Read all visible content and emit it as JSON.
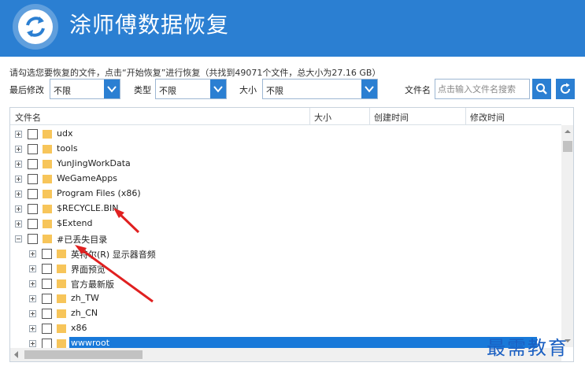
{
  "app": {
    "title": "涂师傅数据恢复"
  },
  "hint": "请勾选您要恢复的文件，点击“开始恢复”进行恢复（共找到49071个文件，总大小为27.16 GB）",
  "filters": {
    "modified_label": "最后修改",
    "modified_value": "不限",
    "type_label": "类型",
    "type_value": "不限",
    "size_label": "大小",
    "size_value": "不限",
    "filename_label": "文件名",
    "filename_placeholder": "点击输入文件名搜索"
  },
  "columns": {
    "name": "文件名",
    "size": "大小",
    "created": "创建时间",
    "modified": "修改时间"
  },
  "rows": [
    {
      "label": "udx",
      "level": 0,
      "expander": "plus",
      "selected": false
    },
    {
      "label": "tools",
      "level": 0,
      "expander": "plus",
      "selected": false
    },
    {
      "label": "YunJingWorkData",
      "level": 0,
      "expander": "plus",
      "selected": false
    },
    {
      "label": "WeGameApps",
      "level": 0,
      "expander": "plus",
      "selected": false
    },
    {
      "label": "Program Files (x86)",
      "level": 0,
      "expander": "plus",
      "selected": false
    },
    {
      "label": "$RECYCLE.BIN",
      "level": 0,
      "expander": "plus",
      "selected": false
    },
    {
      "label": "$Extend",
      "level": 0,
      "expander": "plus",
      "selected": false
    },
    {
      "label": "#已丢失目录",
      "level": 0,
      "expander": "minus",
      "selected": false
    },
    {
      "label": "英特尔(R) 显示器音频",
      "level": 1,
      "expander": "plus",
      "selected": false
    },
    {
      "label": "界面预览",
      "level": 1,
      "expander": "plus",
      "selected": false
    },
    {
      "label": "官方最新版",
      "level": 1,
      "expander": "plus",
      "selected": false
    },
    {
      "label": "zh_TW",
      "level": 1,
      "expander": "plus",
      "selected": false
    },
    {
      "label": "zh_CN",
      "level": 1,
      "expander": "plus",
      "selected": false
    },
    {
      "label": "x86",
      "level": 1,
      "expander": "plus",
      "selected": false
    },
    {
      "label": "wwwroot",
      "level": 1,
      "expander": "plus",
      "selected": true
    }
  ],
  "watermark": "最需教育",
  "colors": {
    "accent": "#2b7fd2",
    "selection": "#1879d9",
    "annotation": "#e02020",
    "folder": "#f7c55a"
  },
  "icons": {
    "logo": "refresh-logo-icon",
    "search": "search-icon",
    "refresh": "refresh-icon",
    "dropdown": "chevron-down-icon",
    "folder": "folder-icon"
  }
}
